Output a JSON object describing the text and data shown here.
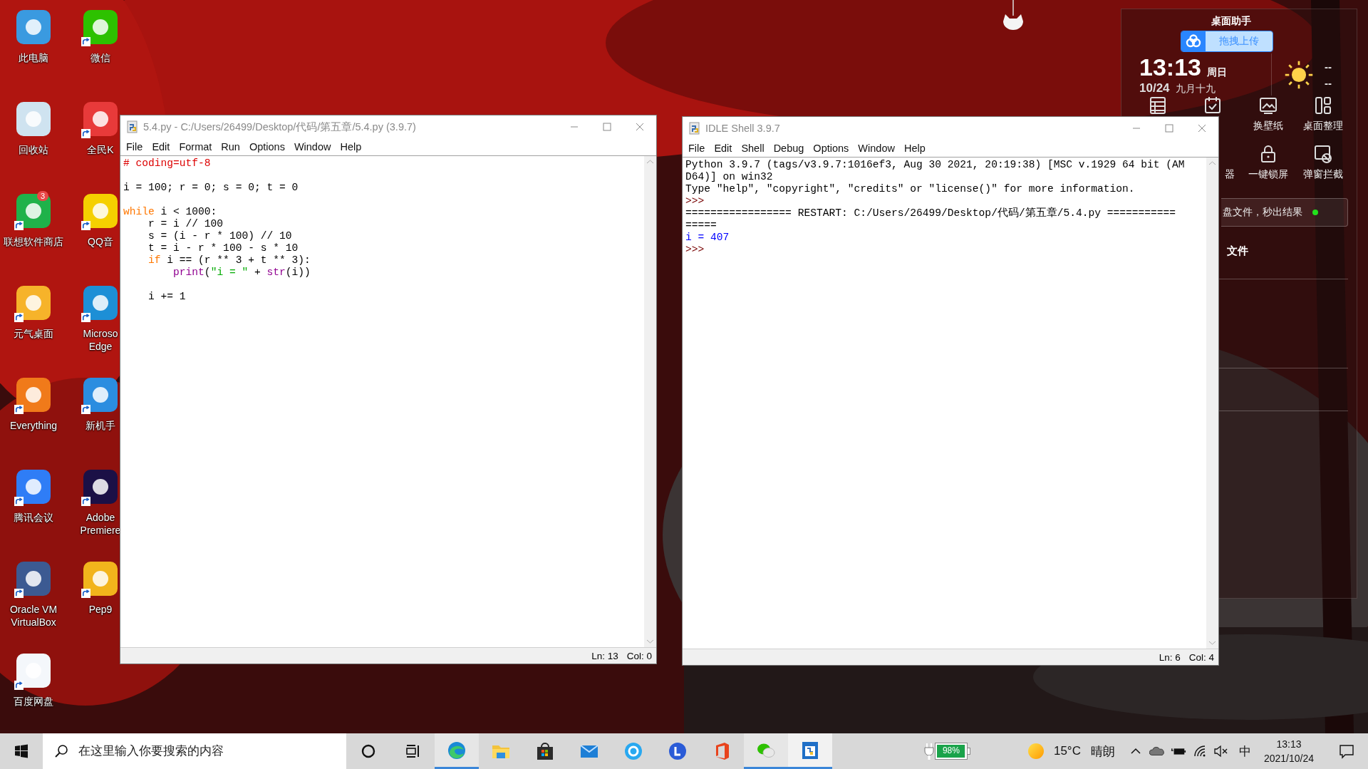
{
  "desktop_icons": [
    {
      "label": "此电脑",
      "color": "#3a9ae0",
      "shortcut": false
    },
    {
      "label": "微信",
      "color": "#2dc100",
      "shortcut": true
    },
    {
      "label": "回收站",
      "color": "#cfe3f0",
      "shortcut": false
    },
    {
      "label": "全民K",
      "color": "#e83a3a",
      "shortcut": true
    },
    {
      "label": "联想软件商店",
      "color": "#1fb24a",
      "shortcut": true,
      "badge": "3"
    },
    {
      "label": "QQ音",
      "color": "#f5d000",
      "shortcut": true
    },
    {
      "label": "元气桌面",
      "color": "#f6b32a",
      "shortcut": true
    },
    {
      "label": "Microso Edge",
      "color": "#1d8fd6",
      "shortcut": true
    },
    {
      "label": "Everything",
      "color": "#f07a1a",
      "shortcut": true
    },
    {
      "label": "新机手",
      "color": "#2b8de0",
      "shortcut": true
    },
    {
      "label": "腾讯会议",
      "color": "#2f7df6",
      "shortcut": true
    },
    {
      "label": "Adobe Premiere",
      "color": "#1b1046",
      "shortcut": true
    },
    {
      "label": "Oracle VM VirtualBox",
      "color": "#3c5a92",
      "shortcut": true
    },
    {
      "label": "Pep9",
      "color": "#f2b41c",
      "shortcut": true
    },
    {
      "label": "百度网盘",
      "color": "#f4f7fb",
      "shortcut": true
    }
  ],
  "editor": {
    "title": "5.4.py - C:/Users/26499/Desktop/代码/第五章/5.4.py (3.9.7)",
    "menus": [
      "File",
      "Edit",
      "Format",
      "Run",
      "Options",
      "Window",
      "Help"
    ],
    "lines": [
      {
        "segments": [
          {
            "kind": "comment",
            "text": "# coding=utf-8"
          }
        ]
      },
      {
        "gap_before": true,
        "segments": [
          {
            "kind": "plain",
            "text": "i = 100; r = 0; s = 0; t = 0"
          }
        ]
      },
      {
        "gap_before": true,
        "segments": [
          {
            "kind": "keyword",
            "text": "while"
          },
          {
            "kind": "plain",
            "text": " i < 1000:"
          }
        ]
      },
      {
        "segments": [
          {
            "kind": "plain",
            "text": "    r = i // 100"
          }
        ]
      },
      {
        "segments": [
          {
            "kind": "plain",
            "text": "    s = (i - r * 100) // 10"
          }
        ]
      },
      {
        "segments": [
          {
            "kind": "plain",
            "text": "    t = i - r * 100 - s * 10"
          }
        ]
      },
      {
        "segments": [
          {
            "kind": "keyword",
            "text": "    if"
          },
          {
            "kind": "plain",
            "text": " i == (r ** 3 + t ** 3):"
          }
        ]
      },
      {
        "segments": [
          {
            "kind": "builtin",
            "text": "        print"
          },
          {
            "kind": "plain",
            "text": "("
          },
          {
            "kind": "string",
            "text": "\"i = \""
          },
          {
            "kind": "plain",
            "text": " + "
          },
          {
            "kind": "builtin",
            "text": "str"
          },
          {
            "kind": "plain",
            "text": "(i))"
          }
        ]
      },
      {
        "gap_before": true,
        "segments": [
          {
            "kind": "plain",
            "text": "    i += 1"
          }
        ]
      }
    ],
    "status": {
      "line": "Ln: 13",
      "column": "Col: 0"
    }
  },
  "shell": {
    "title": "IDLE Shell 3.9.7",
    "menus": [
      "File",
      "Edit",
      "Shell",
      "Debug",
      "Options",
      "Window",
      "Help"
    ],
    "lines": [
      {
        "kind": "stdout",
        "text": "Python 3.9.7 (tags/v3.9.7:1016ef3, Aug 30 2021, 20:19:38) [MSC v.1929 64 bit (AM"
      },
      {
        "kind": "stdout",
        "text": "D64)] on win32"
      },
      {
        "kind": "stdout",
        "text": "Type \"help\", \"copyright\", \"credits\" or \"license()\" for more information."
      },
      {
        "kind": "prompt",
        "text": ">>>"
      },
      {
        "kind": "stdout",
        "text": "================= RESTART: C:/Users/26499/Desktop/代码/第五章/5.4.py ==========="
      },
      {
        "kind": "stdout",
        "text": "====="
      },
      {
        "kind": "output",
        "text": "i = 407"
      },
      {
        "kind": "prompt",
        "text": ">>>"
      }
    ],
    "status": {
      "line": "Ln: 6",
      "column": "Col: 4"
    }
  },
  "widget": {
    "title": "桌面助手",
    "upload_badge": "拖拽上传",
    "time": "13:13",
    "weekday": "周日",
    "date": "10/24",
    "lunar_date": "九月十九",
    "weather_high": "--",
    "weather_low": "--",
    "tools": [
      {
        "kind": "icon_only"
      },
      {
        "kind": "icon_only"
      },
      {
        "kind": "full",
        "label": "换壁纸"
      },
      {
        "kind": "full",
        "label": "桌面整理"
      },
      {
        "kind": "hidden"
      },
      {
        "kind": "label_only",
        "label": "器"
      },
      {
        "kind": "full",
        "label": "一键锁屏"
      },
      {
        "kind": "full",
        "label": "弹窗拦截"
      }
    ],
    "search_hint": "盘文件，秒出结果",
    "tab": "文件"
  },
  "taskbar": {
    "search": {
      "placeholder": "在这里输入你要搜索的内容"
    },
    "apps": [
      {
        "running": true,
        "selected": false
      },
      {
        "running": false,
        "selected": false
      },
      {
        "running": false,
        "selected": false
      },
      {
        "running": false,
        "selected": false
      },
      {
        "running": false,
        "selected": false
      },
      {
        "running": false,
        "selected": false
      },
      {
        "running": false,
        "selected": false
      },
      {
        "running": true,
        "selected": false
      },
      {
        "running": true,
        "selected": true
      }
    ],
    "battery": {
      "level": 0.98,
      "reading": "98%"
    },
    "weather": {
      "temperature": "15°C",
      "condition": "晴朗"
    },
    "muted": true,
    "ime": "中",
    "clock": {
      "time": "13:13",
      "date": "2021/10/24"
    }
  }
}
